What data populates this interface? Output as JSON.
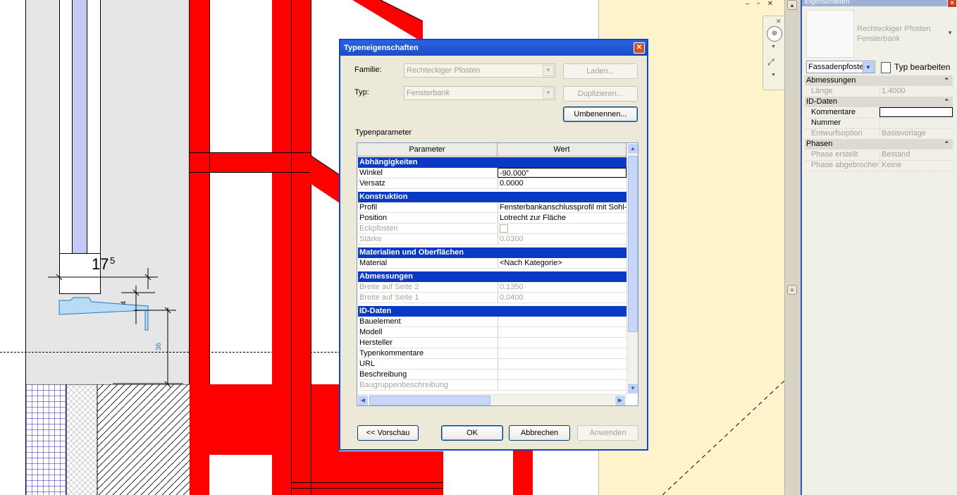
{
  "canvas": {
    "dim_main": "17",
    "dim_main_sup": "5",
    "dim_small": "4",
    "dim_vertical": "36",
    "window_controls": "– ▫ ✕"
  },
  "dialog": {
    "title": "Typeneigenschaften",
    "familie_label": "Familie:",
    "familie_value": "Rechteckiger Pfosten",
    "typ_label": "Typ:",
    "typ_value": "Fensterbank",
    "laden": "Laden...",
    "duplizieren": "Duplizieren...",
    "umbenennen": "Umbenennen...",
    "typparameter_label": "Typenparameter",
    "col_parameter": "Parameter",
    "col_wert": "Wert",
    "sections": [
      {
        "title": "Abhängigkeiten",
        "rows": [
          {
            "k": "Winkel",
            "v": "-90.000°"
          },
          {
            "k": "Versatz",
            "v": "0.0000"
          }
        ]
      },
      {
        "title": "Konstruktion",
        "rows": [
          {
            "k": "Profil",
            "v": "Fensterbankanschlussprofil mit Sohl- u"
          },
          {
            "k": "Position",
            "v": "Lotrecht zur Fläche"
          },
          {
            "k": "Eckpfosten",
            "v": ""
          },
          {
            "k": "Stärke",
            "v": "0.0300"
          }
        ]
      },
      {
        "title": "Materialien und Oberflächen",
        "rows": [
          {
            "k": "Material",
            "v": "<Nach Kategorie>"
          }
        ]
      },
      {
        "title": "Abmessungen",
        "rows": [
          {
            "k": "Breite auf Seite 2",
            "v": "0.1350"
          },
          {
            "k": "Breite auf Seite 1",
            "v": "0.0400"
          }
        ]
      },
      {
        "title": "ID-Daten",
        "rows": [
          {
            "k": "Bauelement",
            "v": ""
          },
          {
            "k": "Modell",
            "v": ""
          },
          {
            "k": "Hersteller",
            "v": ""
          },
          {
            "k": "Typenkommentare",
            "v": ""
          },
          {
            "k": "URL",
            "v": ""
          },
          {
            "k": "Beschreibung",
            "v": ""
          },
          {
            "k": "Baugruppenbeschreibung",
            "v": ""
          }
        ]
      }
    ],
    "btn_vorschau": "<< Vorschau",
    "btn_ok": "OK",
    "btn_abbrechen": "Abbrechen",
    "btn_anwenden": "Anwenden"
  },
  "properties": {
    "title": "Eigenschaften",
    "type_name_line1": "Rechteckiger Pfosten",
    "type_name_line2": "Fensterbank",
    "instance_select": "Fassadenpfoste",
    "edit_type": "Typ bearbeiten",
    "cat_abmessungen": "Abmessungen",
    "cat_iddaten": "ID-Daten",
    "cat_phasen": "Phasen",
    "rows_abm": [
      {
        "k": "Länge",
        "v": "1.4000"
      }
    ],
    "rows_id": [
      {
        "k": "Kommentare",
        "v": ""
      },
      {
        "k": "Nummer",
        "v": ""
      },
      {
        "k": "Entwurfsoption",
        "v": "Basisvorlage"
      }
    ],
    "rows_ph": [
      {
        "k": "Phase erstellt",
        "v": "Bestand"
      },
      {
        "k": "Phase abgebrochen",
        "v": "Keine"
      }
    ]
  }
}
